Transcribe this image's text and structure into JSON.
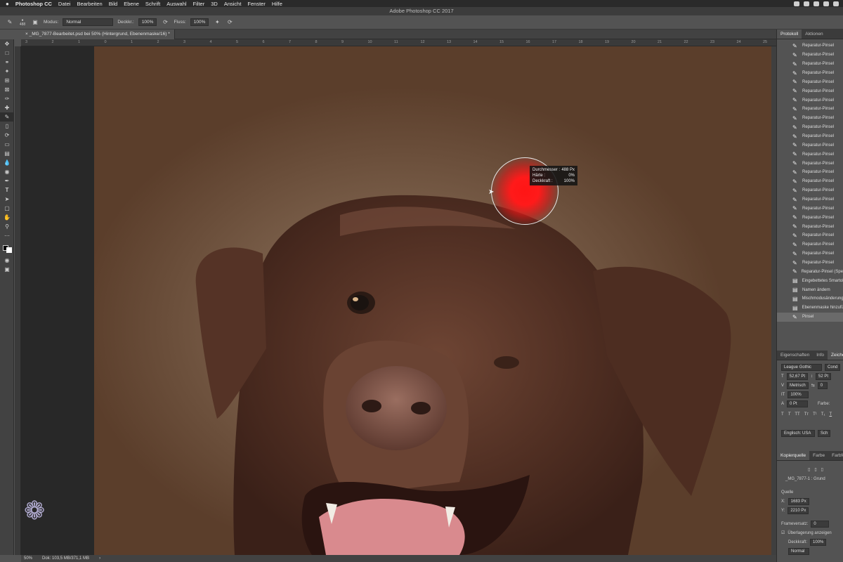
{
  "menubar": {
    "app": "Photoshop CC",
    "items": [
      "Datei",
      "Bearbeiten",
      "Bild",
      "Ebene",
      "Schrift",
      "Auswahl",
      "Filter",
      "3D",
      "Ansicht",
      "Fenster",
      "Hilfe"
    ]
  },
  "window_title": "Adobe Photoshop CC 2017",
  "options": {
    "brush_size": "488",
    "mode_label": "Modus:",
    "mode_value": "Normal",
    "opacity_label": "Deckkr.:",
    "opacity_value": "100%",
    "flow_label": "Fluss:",
    "flow_value": "100%"
  },
  "document_tab": "_MG_7877-Bearbeitet.psd bei 50% (Hintergrund, Ebenenmaske/16) *",
  "ruler_ticks": [
    "3",
    "2",
    "1",
    "0",
    "1",
    "2",
    "3",
    "4",
    "5",
    "6",
    "7",
    "8",
    "9",
    "10",
    "11",
    "12",
    "13",
    "14",
    "15",
    "16",
    "17",
    "18",
    "19",
    "20",
    "21",
    "22",
    "23",
    "24",
    "25"
  ],
  "brush_tooltip": {
    "diameter_label": "Durchmesser :",
    "diameter_value": "488 Px",
    "hardness_label": "Härte :",
    "hardness_value": "0%",
    "opacity_label": "Deckkraft :",
    "opacity_value": "100%"
  },
  "status": {
    "zoom": "50%",
    "doc": "Dok: 103,5 MB/371,1 MB"
  },
  "history_panel": {
    "tabs": [
      "Protokoll",
      "Aktionen"
    ],
    "items": [
      "Reparatur-Pinsel",
      "Reparatur-Pinsel",
      "Reparatur-Pinsel",
      "Reparatur-Pinsel",
      "Reparatur-Pinsel",
      "Reparatur-Pinsel",
      "Reparatur-Pinsel",
      "Reparatur-Pinsel",
      "Reparatur-Pinsel",
      "Reparatur-Pinsel",
      "Reparatur-Pinsel",
      "Reparatur-Pinsel",
      "Reparatur-Pinsel",
      "Reparatur-Pinsel",
      "Reparatur-Pinsel",
      "Reparatur-Pinsel",
      "Reparatur-Pinsel",
      "Reparatur-Pinsel",
      "Reparatur-Pinsel",
      "Reparatur-Pinsel",
      "Reparatur-Pinsel",
      "Reparatur-Pinsel",
      "Reparatur-Pinsel",
      "Reparatur-Pinsel",
      "Reparatur-Pinsel",
      "Reparatur-Pinsel (Spe",
      "Eingebettetes Smartob",
      "Namen ändern",
      "Mischmodusänderung",
      "Ebenenmaske hinzufüg",
      "Pinsel"
    ]
  },
  "props_panel": {
    "tabs": [
      "Eigenschaften",
      "Info",
      "Zeichen"
    ],
    "font": "League Gothic",
    "font_style": "Cond",
    "size": "52,67 Pt",
    "leading": "52 Pt",
    "kerning": "Metrisch",
    "tracking": "0",
    "vscale": "100%",
    "baseline": "0 Pt",
    "color_label": "Farbe:",
    "language": "Englisch: USA",
    "aa": "Sch"
  },
  "clone_panel": {
    "tabs": [
      "Kopierquelle",
      "Farbe",
      "Farbfel"
    ],
    "source_name": "_MG_7877-1 : Grund",
    "source_label": "Quelle",
    "x": "1683 Px",
    "y": "2210 Px",
    "frame_offset_label": "Frameversatz:",
    "frame_offset": "0",
    "show_overlay": "Überlagerung anzeigen",
    "overlay_opacity_label": "Deckkraft:",
    "overlay_opacity": "100%",
    "overlay_mode": "Normal"
  }
}
